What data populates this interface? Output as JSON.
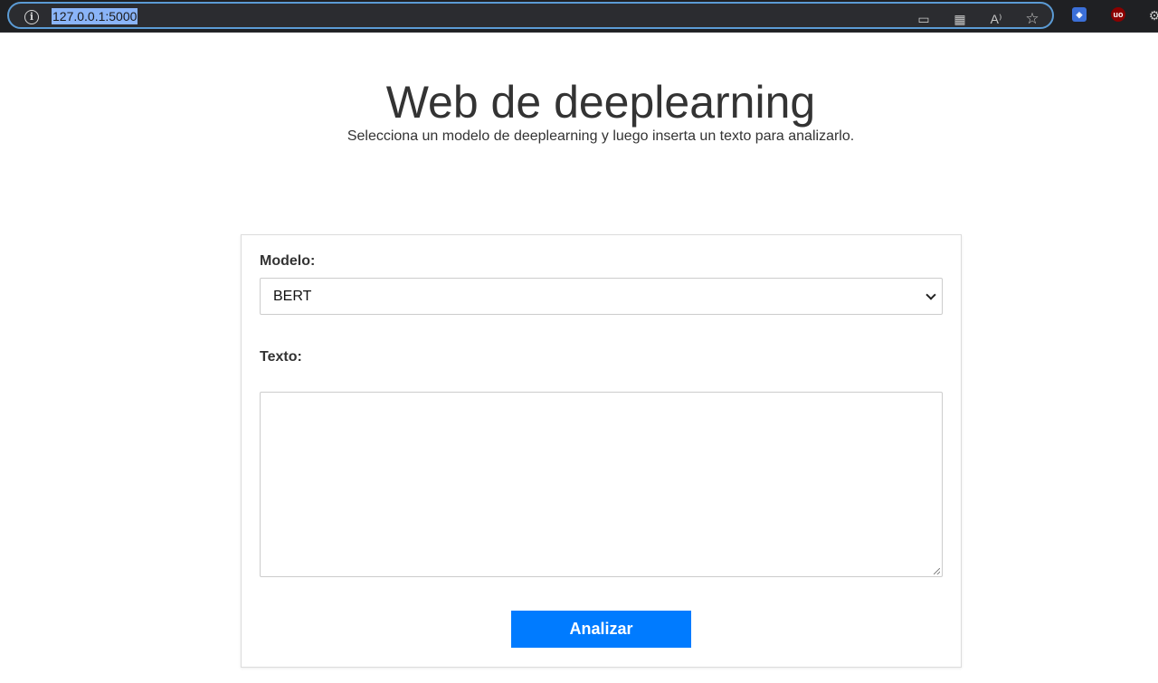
{
  "browser": {
    "url": "127.0.0.1:5000",
    "icons": [
      "info-icon",
      "cast-icon",
      "apps-icon",
      "read-aloud-icon",
      "favorite-star-icon",
      "extension-shield-icon",
      "ublock-icon",
      "extensions-puzzle-icon"
    ],
    "read_aloud_glyph": "A⁾",
    "ublock_glyph": "uo"
  },
  "header": {
    "title": "Web de deeplearning",
    "subtitle": "Selecciona un modelo de deeplearning y luego inserta un texto para analizarlo."
  },
  "form": {
    "model_label": "Modelo:",
    "model_selected": "BERT",
    "text_label": "Texto:",
    "text_value": "",
    "submit_label": "Analizar"
  },
  "colors": {
    "button": "#007bff",
    "address_focus": "#5b9bd5",
    "browser_bar": "#1f2023"
  }
}
